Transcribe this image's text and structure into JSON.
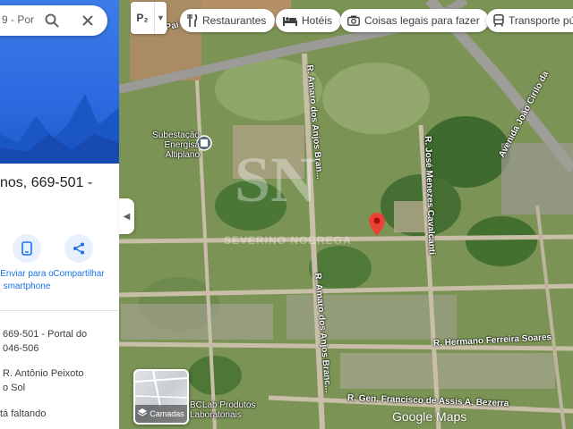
{
  "map": {
    "roads": {
      "avenida": "Avenida João Cirilo da",
      "amaro1": "R. Amaro dos Anjos Bran...",
      "amaro2": "R. Amaro dos Anjos Branc...",
      "jose": "R. José Menezes Cavalcanti",
      "hermano": "R. Hermano Ferreira Soares",
      "francisco": "R. Gen. Francisco de Assis A. Bezerra",
      "pai": "Pai"
    },
    "pois": {
      "subestacao": "Subestação Energisa Altiplano",
      "bclab": "BCLab Produtos Laboratoriais"
    },
    "watermark_big": "SN",
    "watermark_small": "SEVERINO NOBREGA",
    "google_logo": "Google Maps"
  },
  "search": {
    "value": "9 - Por"
  },
  "place": {
    "title_line1": "nos, 669-501 -",
    "title_line2": "",
    "actions": [
      {
        "label": "Enviar para o smartphone",
        "icon": "phone-icon"
      },
      {
        "label": "Compartilhar",
        "icon": "share-icon"
      }
    ],
    "info": [
      {
        "line1": "669-501 - Portal do",
        "line2": "046-506"
      },
      {
        "line1": "R. Antônio Peixoto",
        "line2": "o Sol"
      },
      {
        "line1": "tá faltando",
        "line2": ""
      }
    ]
  },
  "maptype": {
    "label": "P₂"
  },
  "chips": [
    {
      "label": "Restaurantes",
      "icon": "restaurant-icon"
    },
    {
      "label": "Hotéis",
      "icon": "hotel-icon"
    },
    {
      "label": "Coisas legais para fazer",
      "icon": "camera-icon"
    },
    {
      "label": "Transporte pú",
      "icon": "transit-icon"
    }
  ],
  "layers": {
    "label": "Camadas"
  },
  "colors": {
    "accent": "#1a73e8",
    "pin": "#ea4335",
    "hero": "#2c6be0"
  }
}
